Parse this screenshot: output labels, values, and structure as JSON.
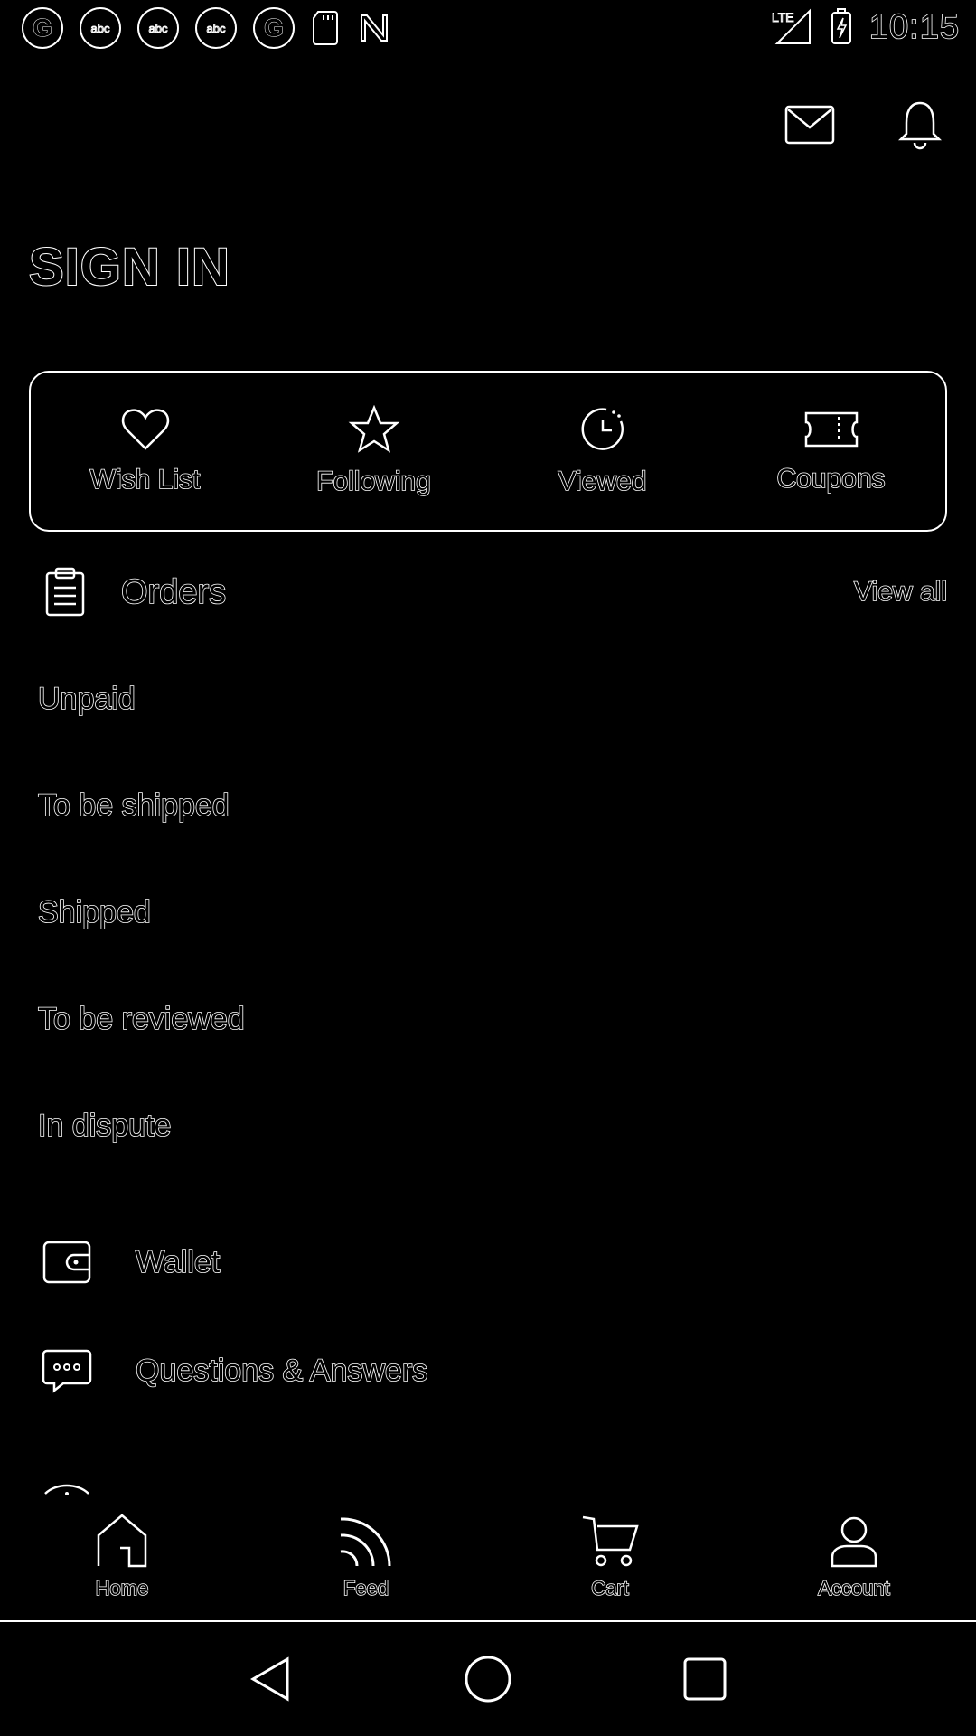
{
  "status_bar": {
    "time": "10:15",
    "network": "LTE",
    "icons": [
      "guardian-icon",
      "abc-news-icon",
      "abc-news-icon",
      "abc-news-icon",
      "guardian-icon",
      "sd-card-icon",
      "nyt-icon"
    ]
  },
  "status_icon_text": {
    "g": "G",
    "abc": "abc"
  },
  "header": {
    "title": "SIGN IN",
    "icons": [
      "mail-icon",
      "bell-icon"
    ]
  },
  "quick_links": [
    {
      "label": "Wish List",
      "icon": "heart-icon"
    },
    {
      "label": "Following",
      "icon": "star-icon"
    },
    {
      "label": "Viewed",
      "icon": "clock-icon"
    },
    {
      "label": "Coupons",
      "icon": "coupon-icon"
    }
  ],
  "orders": {
    "title": "Orders",
    "view_all": "View all",
    "statuses": [
      "Unpaid",
      "To be shipped",
      "Shipped",
      "To be reviewed",
      "In dispute"
    ]
  },
  "menu": [
    {
      "label": "Wallet",
      "icon": "wallet-icon"
    },
    {
      "label": "Questions & Answers",
      "icon": "chat-icon"
    }
  ],
  "bottom_nav": [
    {
      "label": "Home",
      "icon": "home-icon"
    },
    {
      "label": "Feed",
      "icon": "feed-icon"
    },
    {
      "label": "Cart",
      "icon": "cart-icon"
    },
    {
      "label": "Account",
      "icon": "account-icon"
    }
  ],
  "system_nav": [
    "back-icon",
    "home-circle-icon",
    "recents-icon"
  ],
  "colors": {
    "background": "#000000",
    "outline": "#ffffff"
  }
}
